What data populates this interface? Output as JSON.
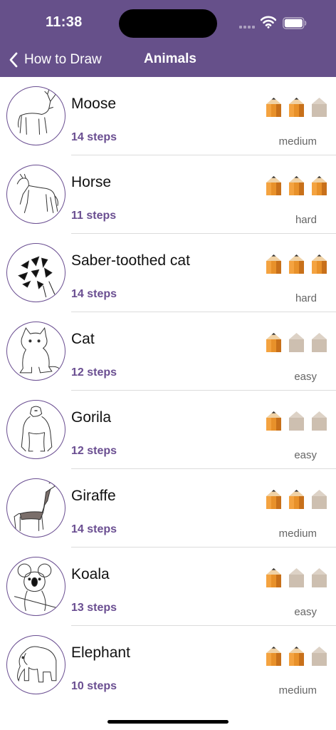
{
  "status_bar": {
    "time": "11:38"
  },
  "nav": {
    "back_label": "How to Draw",
    "title": "Animals"
  },
  "colors": {
    "header": "#66508a",
    "accent": "#6a4e91",
    "pencil_on": "#e8912a",
    "pencil_off": "#cdbfb0"
  },
  "animals": [
    {
      "name": "Moose",
      "steps": "14 steps",
      "difficulty": "medium",
      "level": 2
    },
    {
      "name": "Horse",
      "steps": "11 steps",
      "difficulty": "hard",
      "level": 3
    },
    {
      "name": "Saber-toothed cat",
      "steps": "14 steps",
      "difficulty": "hard",
      "level": 3
    },
    {
      "name": "Cat",
      "steps": "12 steps",
      "difficulty": "easy",
      "level": 1
    },
    {
      "name": "Gorila",
      "steps": "12 steps",
      "difficulty": "easy",
      "level": 1
    },
    {
      "name": "Giraffe",
      "steps": "14 steps",
      "difficulty": "medium",
      "level": 2
    },
    {
      "name": "Koala",
      "steps": "13 steps",
      "difficulty": "easy",
      "level": 1
    },
    {
      "name": "Elephant",
      "steps": "10 steps",
      "difficulty": "medium",
      "level": 2
    }
  ]
}
